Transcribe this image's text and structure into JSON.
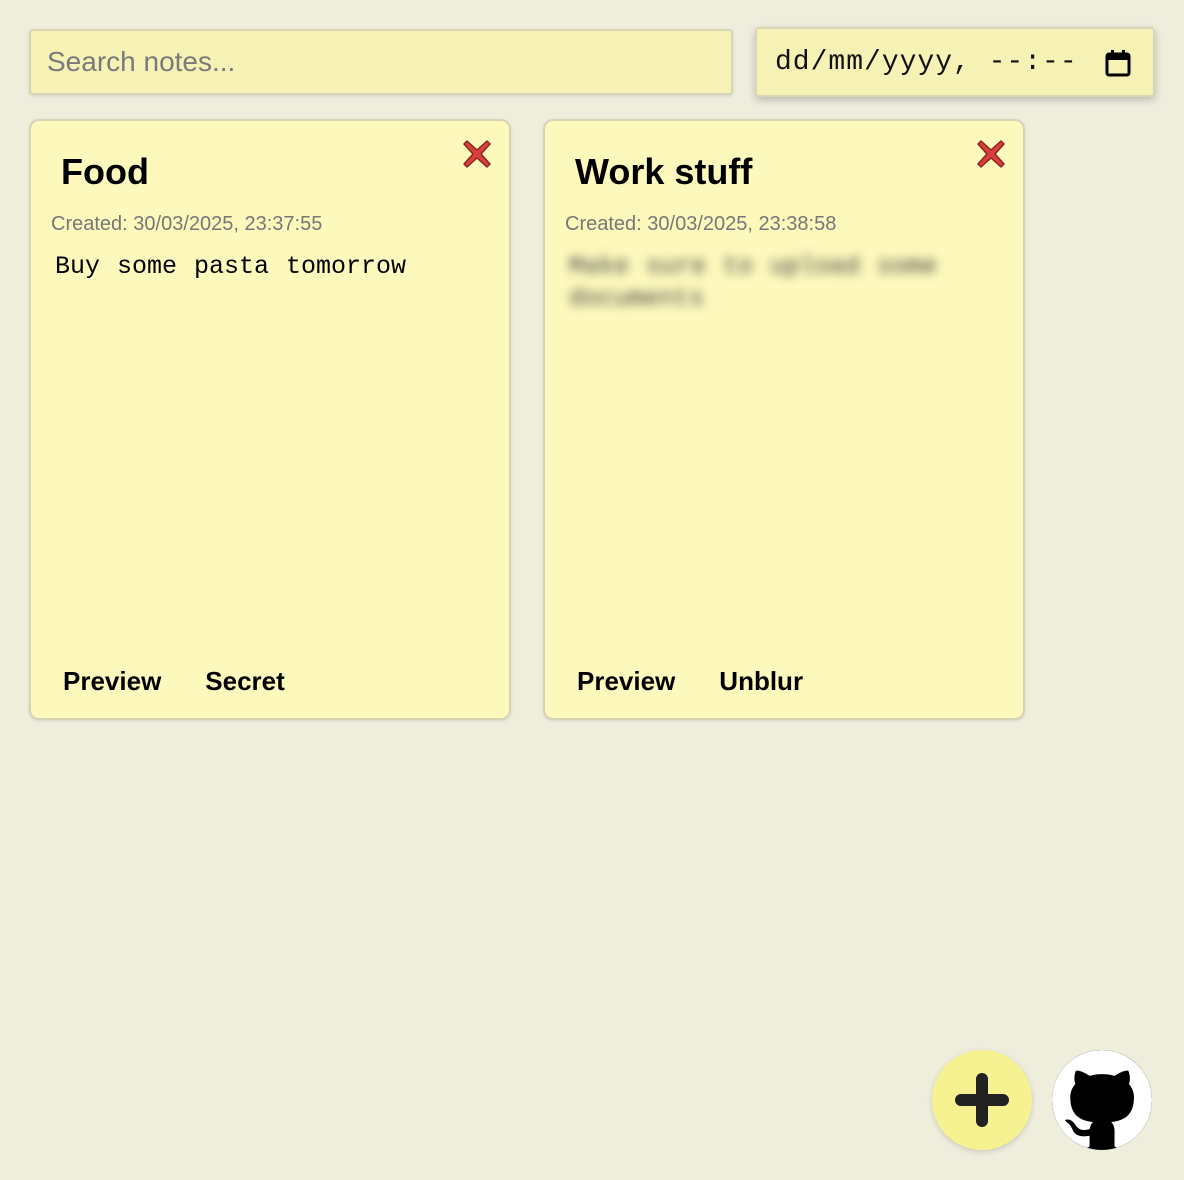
{
  "search": {
    "placeholder": "Search notes..."
  },
  "date_filter": {
    "value": "dd/mm/yyyy, --:--",
    "icon": "calendar-icon"
  },
  "notes": [
    {
      "title": "Food",
      "created": "Created: 30/03/2025, 23:37:55",
      "body": "Buy some pasta tomorrow",
      "blurred": false,
      "actions": [
        "Preview",
        "Secret"
      ]
    },
    {
      "title": "Work stuff",
      "created": "Created: 30/03/2025, 23:38:58",
      "body": "Make sure to upload some documents",
      "blurred": true,
      "actions": [
        "Preview",
        "Unblur"
      ]
    }
  ],
  "colors": {
    "background": "#efeddc",
    "note": "#fdf8bc",
    "input": "#f6f2b5",
    "close_red": "#d9403a",
    "add_button": "#f6f291"
  }
}
